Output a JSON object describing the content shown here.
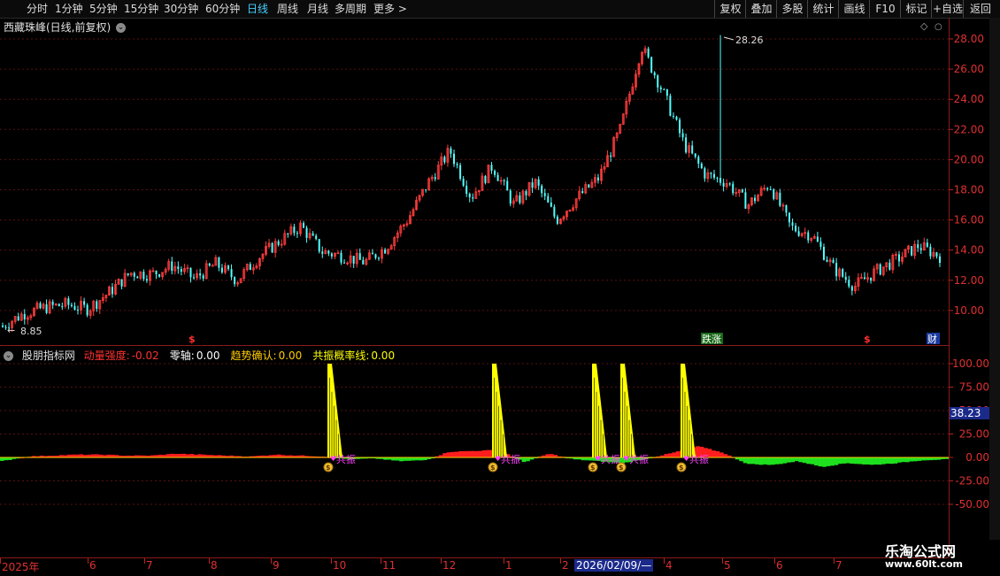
{
  "toolbar": {
    "timeframes": [
      "分时",
      "1分钟",
      "5分钟",
      "15分钟",
      "30分钟",
      "60分钟",
      "日线",
      "周线",
      "月线",
      "多周期",
      "更多 >"
    ],
    "active": "日线",
    "right_buttons": [
      "复权",
      "叠加",
      "多股",
      "统计",
      "画线",
      "F10",
      "标记",
      "+自选",
      "返回"
    ]
  },
  "chart": {
    "title": "西藏珠峰(日线,前复权)",
    "high_label": "28.26",
    "low_label": "8.85",
    "price_ticks": [
      "28.00",
      "26.00",
      "24.00",
      "22.00",
      "20.00",
      "18.00",
      "16.00",
      "14.00",
      "12.00",
      "10.00"
    ],
    "markers": [
      "$",
      "跌涨",
      "$",
      "财"
    ]
  },
  "indicator": {
    "name": "股朋指标网",
    "items": [
      {
        "label": "动量强度:",
        "value": "-0.02",
        "color": "#ff3030"
      },
      {
        "label": "零轴:",
        "value": "0.00",
        "color": "#ffffff"
      },
      {
        "label": "趋势确认:",
        "value": "0.00",
        "color": "#ffcc00"
      },
      {
        "label": "共振概率线:",
        "value": "0.00",
        "color": "#ffff00"
      }
    ],
    "ticks": [
      "100.00",
      "75.00",
      "50.00",
      "25.00",
      "0.00",
      "-25.00",
      "-50.00"
    ],
    "current_value": "38.23",
    "signal_label": "共振"
  },
  "date_axis": {
    "labels": [
      "2025年",
      "6",
      "7",
      "8",
      "9",
      "10",
      "11",
      "12",
      "1",
      "2",
      "4",
      "5",
      "6",
      "7"
    ],
    "selected": "2026/02/09/—"
  },
  "watermark": {
    "line1": "乐淘公式网",
    "line2": "www.60lt.com"
  },
  "chart_data": [
    {
      "type": "candlestick",
      "title": "西藏珠峰(日线,前复权)",
      "xlabel": "",
      "ylabel": "",
      "ylim": [
        9,
        29
      ],
      "x": [
        "2025年",
        "6",
        "7",
        "8",
        "9",
        "10",
        "11",
        "12",
        "1",
        "2",
        "4",
        "5",
        "6",
        "7"
      ],
      "close_approx": [
        9.0,
        9.8,
        10.2,
        10.4,
        10.1,
        11.2,
        12.5,
        12.4,
        13.0,
        12.1,
        13.1,
        12.0,
        13.5,
        14.6,
        15.6,
        13.9,
        13.6,
        13.2,
        14.2,
        16.0,
        18.5,
        20.6,
        17.5,
        19.6,
        17.0,
        18.5,
        16.0,
        17.5,
        18.8,
        22.0,
        27.5,
        24.5,
        21.0,
        19.0,
        18.5,
        17.0,
        18.4,
        15.5,
        15.0,
        12.8,
        11.6,
        12.6,
        13.4,
        14.3,
        13.6
      ],
      "high": 28.26,
      "low": 8.85
    },
    {
      "type": "area",
      "title": "股朋指标网",
      "xlabel": "",
      "ylabel": "",
      "ylim": [
        -50,
        100
      ],
      "series": [
        {
          "name": "动量强度",
          "values": [
            -4,
            1,
            2,
            3,
            3,
            2,
            2,
            4,
            3,
            2,
            1,
            3,
            2,
            1,
            -2,
            -1,
            -4,
            -3,
            6,
            7,
            8,
            -5,
            4,
            -2,
            -4,
            -6,
            -1,
            5,
            12,
            5,
            -7,
            -8,
            -4,
            -10,
            -6,
            -8,
            -6,
            -3,
            -2
          ]
        },
        {
          "name": "共振概率线",
          "peaks": [
            100,
            100,
            100,
            100,
            100
          ]
        }
      ]
    }
  ]
}
